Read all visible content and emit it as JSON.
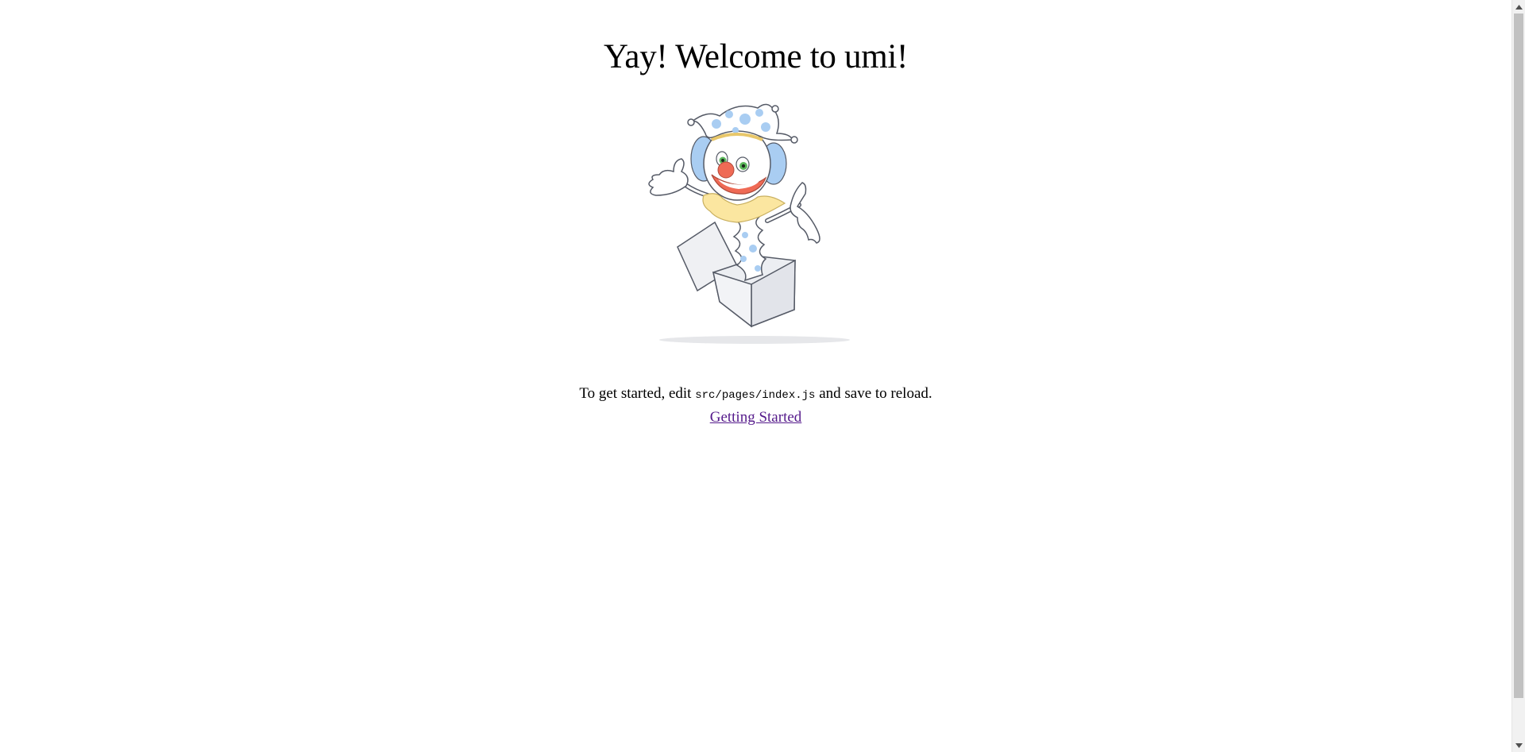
{
  "page": {
    "title": "Yay! Welcome to umi!",
    "intro_before": "To get started, edit ",
    "intro_code": "src/pages/index.js",
    "intro_after": " and save to reload.",
    "link_label": "Getting Started"
  },
  "mascot": {
    "icon": "jester-in-box-illustration"
  },
  "colors": {
    "link": "#551a8b",
    "hat_blue": "#a9cdf2",
    "nose_red": "#ef6a55",
    "collar_yellow": "#fbe6a0",
    "box_gray": "#e9eaee"
  }
}
